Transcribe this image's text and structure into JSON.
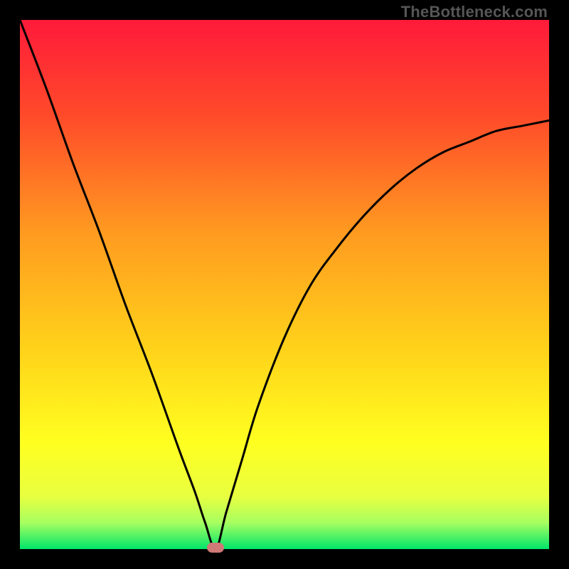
{
  "watermark": "TheBottleneck.com",
  "chart_data": {
    "type": "line",
    "title": "",
    "xlabel": "",
    "ylabel": "",
    "xlim": [
      0,
      100
    ],
    "ylim": [
      0,
      100
    ],
    "grid": false,
    "legend": "none",
    "background_gradient": {
      "top_color": "#ff1a3a",
      "mid_color": "#ffe000",
      "bottom_color": "#00e56a"
    },
    "curve": {
      "description": "V-shaped bottleneck curve with minimum near optimal hardware match",
      "min_x": 37,
      "min_y": 0,
      "x": [
        0,
        5,
        10,
        15,
        20,
        25,
        30,
        33,
        35,
        37,
        39,
        42,
        45,
        50,
        55,
        60,
        65,
        70,
        75,
        80,
        85,
        90,
        95,
        100
      ],
      "y": [
        100,
        87,
        73,
        60,
        46,
        33,
        19,
        11,
        5,
        0,
        7,
        17,
        27,
        40,
        50,
        57,
        63,
        68,
        72,
        75,
        77,
        79,
        80,
        81
      ]
    },
    "marker": {
      "x": 37,
      "y": 0,
      "color": "#cf7a77",
      "shape": "rounded-rect"
    }
  },
  "colors": {
    "page_bg": "#000000",
    "curve_stroke": "#000000",
    "watermark": "#565656"
  }
}
